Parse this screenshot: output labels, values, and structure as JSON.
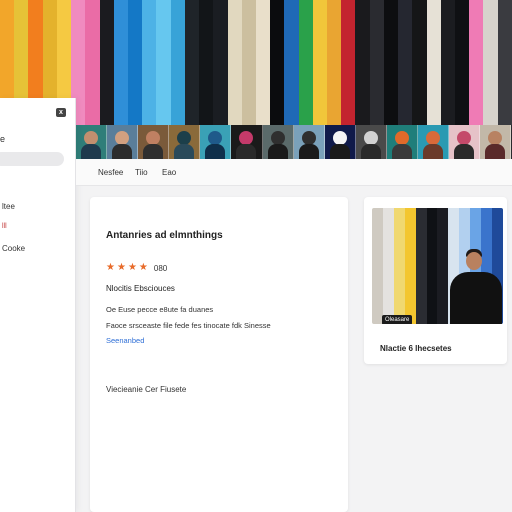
{
  "banner": {
    "stripe_colors": [
      "#f2a62a",
      "#e6c237",
      "#f27e1e",
      "#e4b22c",
      "#f5c942",
      "#f08bbf",
      "#ea6ca6",
      "#1b1b1f",
      "#2f8fd8",
      "#1478c6",
      "#4db2e6",
      "#66c7ef",
      "#38a3d8",
      "#1f2429",
      "#121518",
      "#1a1d22",
      "#e1d8bf",
      "#ccbf9f",
      "#e9dfca",
      "#0b0c0e",
      "#1f69b6",
      "#2aa14a",
      "#f1c63a",
      "#e9a532",
      "#c3242f",
      "#1a1a1d",
      "#2a2b30",
      "#0d0e10",
      "#252730",
      "#151617",
      "#e6e1d6",
      "#1b1c20",
      "#0f1013",
      "#ef7bb5",
      "#d7d3cc",
      "#3a3b40"
    ]
  },
  "thumbnails": {
    "count": 14,
    "colors": [
      {
        "bg": "#2f7e79",
        "skin": "#c28f6f",
        "shirt": "#1f3a4d"
      },
      {
        "bg": "#5a7e9a",
        "skin": "#d2a080",
        "shirt": "#2c2c2c"
      },
      {
        "bg": "#7a5a3a",
        "skin": "#c08062",
        "shirt": "#2f2f2f"
      },
      {
        "bg": "#8a6a3a",
        "skin": "#1c3f4a",
        "shirt": "#2a4a5a"
      },
      {
        "bg": "#3aa1b6",
        "skin": "#1f5a8a",
        "shirt": "#0f2f4a"
      },
      {
        "bg": "#1a1a1a",
        "skin": "#c43a6a",
        "shirt": "#2a2a2a"
      },
      {
        "bg": "#5a6a6a",
        "skin": "#2f2f2f",
        "shirt": "#1a1a1a"
      },
      {
        "bg": "#7aa1ba",
        "skin": "#2f2f2f",
        "shirt": "#1a1a1a"
      },
      {
        "bg": "#101a4a",
        "skin": "#f5f5f5",
        "shirt": "#1a1a1a"
      },
      {
        "bg": "#4a4a4a",
        "skin": "#d2d2d2",
        "shirt": "#2a2a2a"
      },
      {
        "bg": "#1f7e7a",
        "skin": "#e06a2a",
        "shirt": "#3a3a3a"
      },
      {
        "bg": "#2a9ab2",
        "skin": "#d86a3a",
        "shirt": "#6a3a2a"
      },
      {
        "bg": "#e6c2c8",
        "skin": "#c44a6a",
        "shirt": "#2a2a2a"
      },
      {
        "bg": "#c2b8a8",
        "skin": "#b88262",
        "shirt": "#5a2a2a"
      }
    ]
  },
  "sidebar": {
    "close_glyph": "x",
    "top_label": "e",
    "items": [
      {
        "label": "ltee",
        "class": ""
      },
      {
        "label": "lll",
        "class": "red"
      },
      {
        "label": "Cooke",
        "class": ""
      }
    ]
  },
  "tabs": [
    {
      "label": "Nesfee"
    },
    {
      "label": "Tiio"
    },
    {
      "label": "Eao"
    }
  ],
  "card": {
    "title": "Antanries ad elmnthings",
    "rating_stars": 4,
    "rating_count": "080",
    "meta_title": "Nlocitis Ebsciouces",
    "lines": [
      "Oe Euse pecce e8ute fa duanes",
      "Faoce srsceaste file fede fes tinocate fdk Sinesse"
    ],
    "link": "Seenanbed",
    "footer_label": "Viecieanie Cer Fiusete"
  },
  "video_card": {
    "stripe_colors": [
      "#1f4a9a",
      "#3a74cc",
      "#6aa4e6",
      "#b2d0ef",
      "#d8e4ef",
      "#1b1c22",
      "#0f1115",
      "#2a2c32",
      "#f3c62f",
      "#f0d870",
      "#e4e2df",
      "#cfcac1"
    ],
    "badge": "Oleasare",
    "title": "Nlactie 6 lhecsetes"
  },
  "colors": {
    "accent_orange": "#e86b2a",
    "link_blue": "#2f6fd6"
  }
}
